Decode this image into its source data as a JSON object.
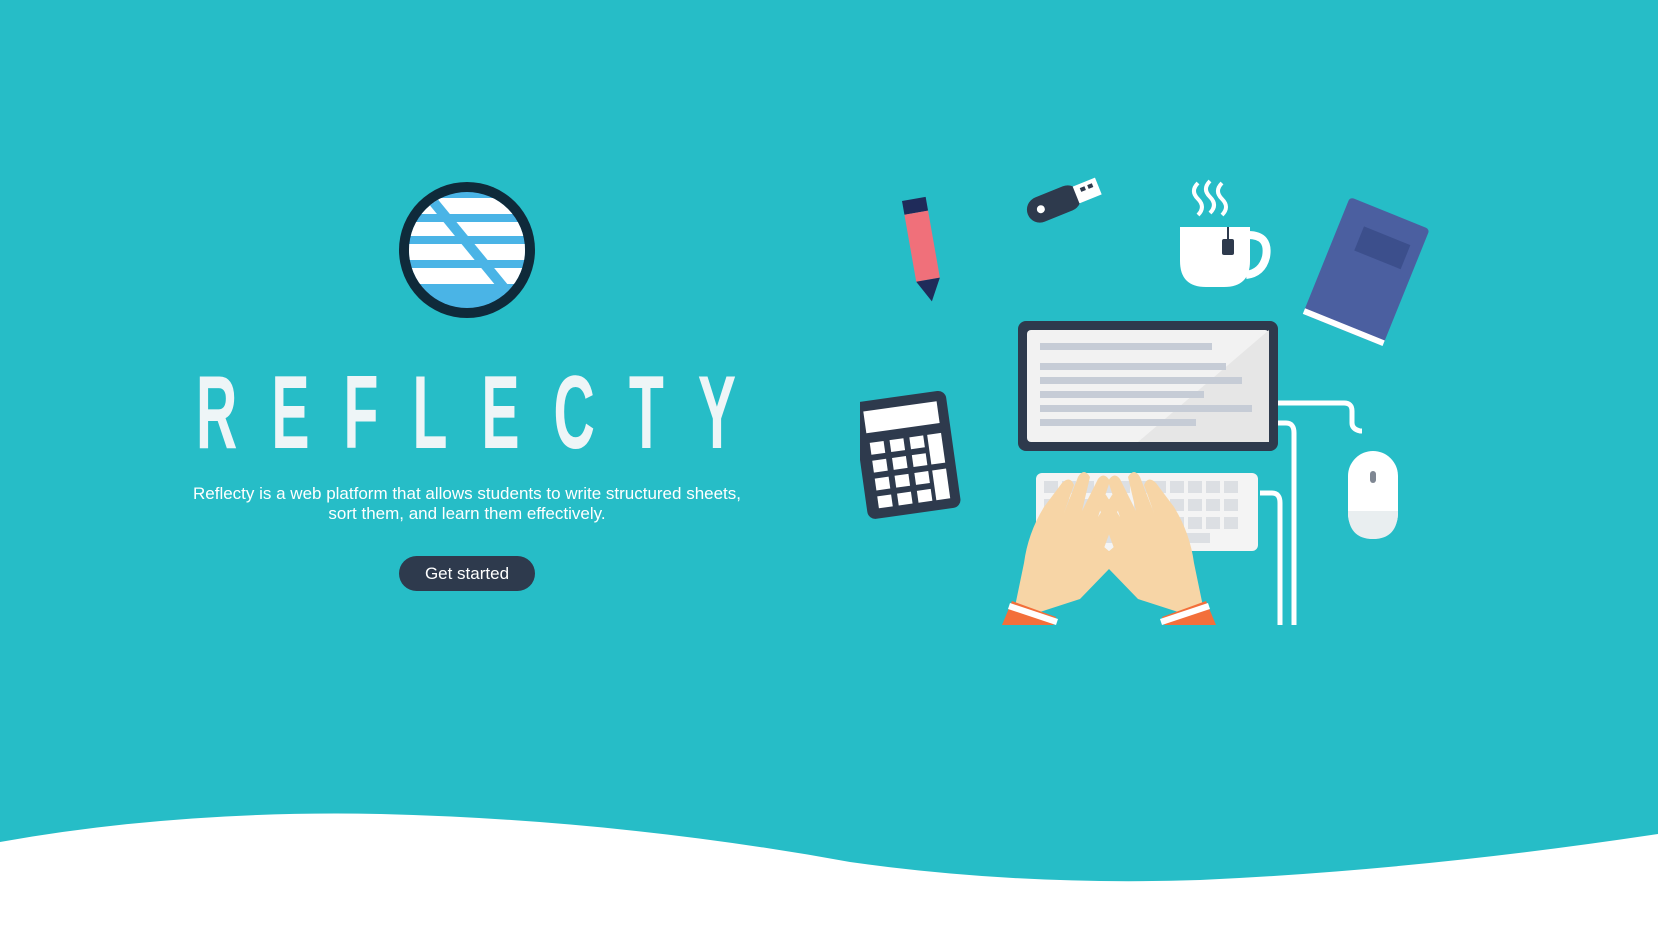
{
  "brand": {
    "name": "REFLECTY",
    "wordmark_letters": [
      "R",
      "E",
      "F",
      "L",
      "E",
      "C",
      "T",
      "Y"
    ],
    "logo_icon": "reflecty-logo-icon"
  },
  "hero": {
    "tagline_line1": "Reflecty is a web platform that allows students to write structured sheets,",
    "tagline_line2": "sort them, and learn them effectively.",
    "cta_label": "Get started"
  },
  "illustration": {
    "items": [
      "pencil-icon",
      "usb-stick-icon",
      "coffee-cup-icon",
      "notebook-icon",
      "calculator-icon",
      "monitor-icon",
      "keyboard-icon",
      "mouse-icon",
      "hands-icon"
    ]
  },
  "colors": {
    "background": "#26bdc7",
    "button": "#2e3a4d",
    "text": "#ffffff",
    "wave": "#ffffff"
  }
}
